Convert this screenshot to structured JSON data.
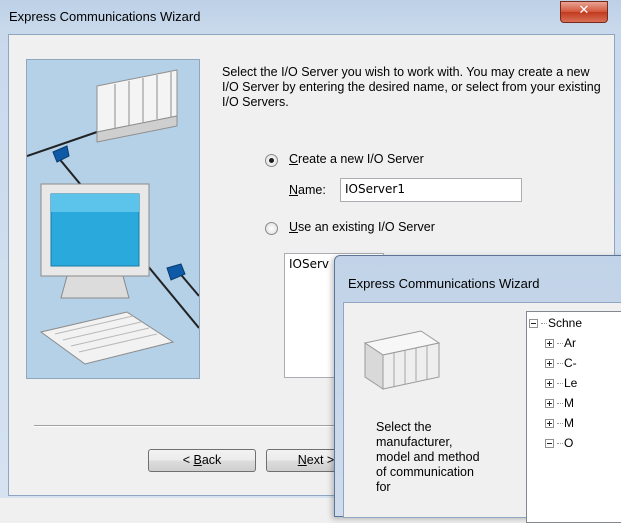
{
  "main_window": {
    "title": "Express Communications Wizard",
    "close_glyph": "✕",
    "description": "Select the I/O Server you wish to work with. You may create a new I/O Server by entering the desired name, or select from your existing I/O Servers.",
    "option_create": {
      "prefix": "",
      "mnemonic": "C",
      "rest": "reate a new I/O Server",
      "selected": true
    },
    "name_label": {
      "mnemonic": "N",
      "rest": "ame:"
    },
    "name_value": "IOServer1",
    "option_existing": {
      "mnemonic": "U",
      "rest": "se an existing I/O Server",
      "selected": false
    },
    "existing_list": [
      "IOServ"
    ],
    "back_button": {
      "prefix": "< ",
      "mnemonic": "B",
      "rest": "ack"
    },
    "next_button": {
      "mnemonic": "N",
      "rest": "ext >"
    }
  },
  "front_window": {
    "title": "Express Communications Wizard",
    "description": "Select the manufacturer, model and method of communication for",
    "tree": [
      {
        "label": "Schne",
        "expander": "minus",
        "level": 0
      },
      {
        "label": "Ar",
        "expander": "plus",
        "level": 1
      },
      {
        "label": "C-",
        "expander": "plus",
        "level": 1
      },
      {
        "label": "Le",
        "expander": "plus",
        "level": 1
      },
      {
        "label": "M",
        "expander": "plus",
        "level": 1
      },
      {
        "label": "M",
        "expander": "plus",
        "level": 1
      },
      {
        "label": "O",
        "expander": "minus",
        "level": 1
      }
    ]
  },
  "colors": {
    "title_bar": "#c9d9ec",
    "close_button": "#c23a1f",
    "hero_background": "#b4d1e8",
    "dialog_face": "#f0f0f0"
  },
  "icons": [
    "close-icon",
    "server-rack-icon",
    "computer-monitor-icon",
    "keyboard-icon",
    "network-connector-icon"
  ]
}
